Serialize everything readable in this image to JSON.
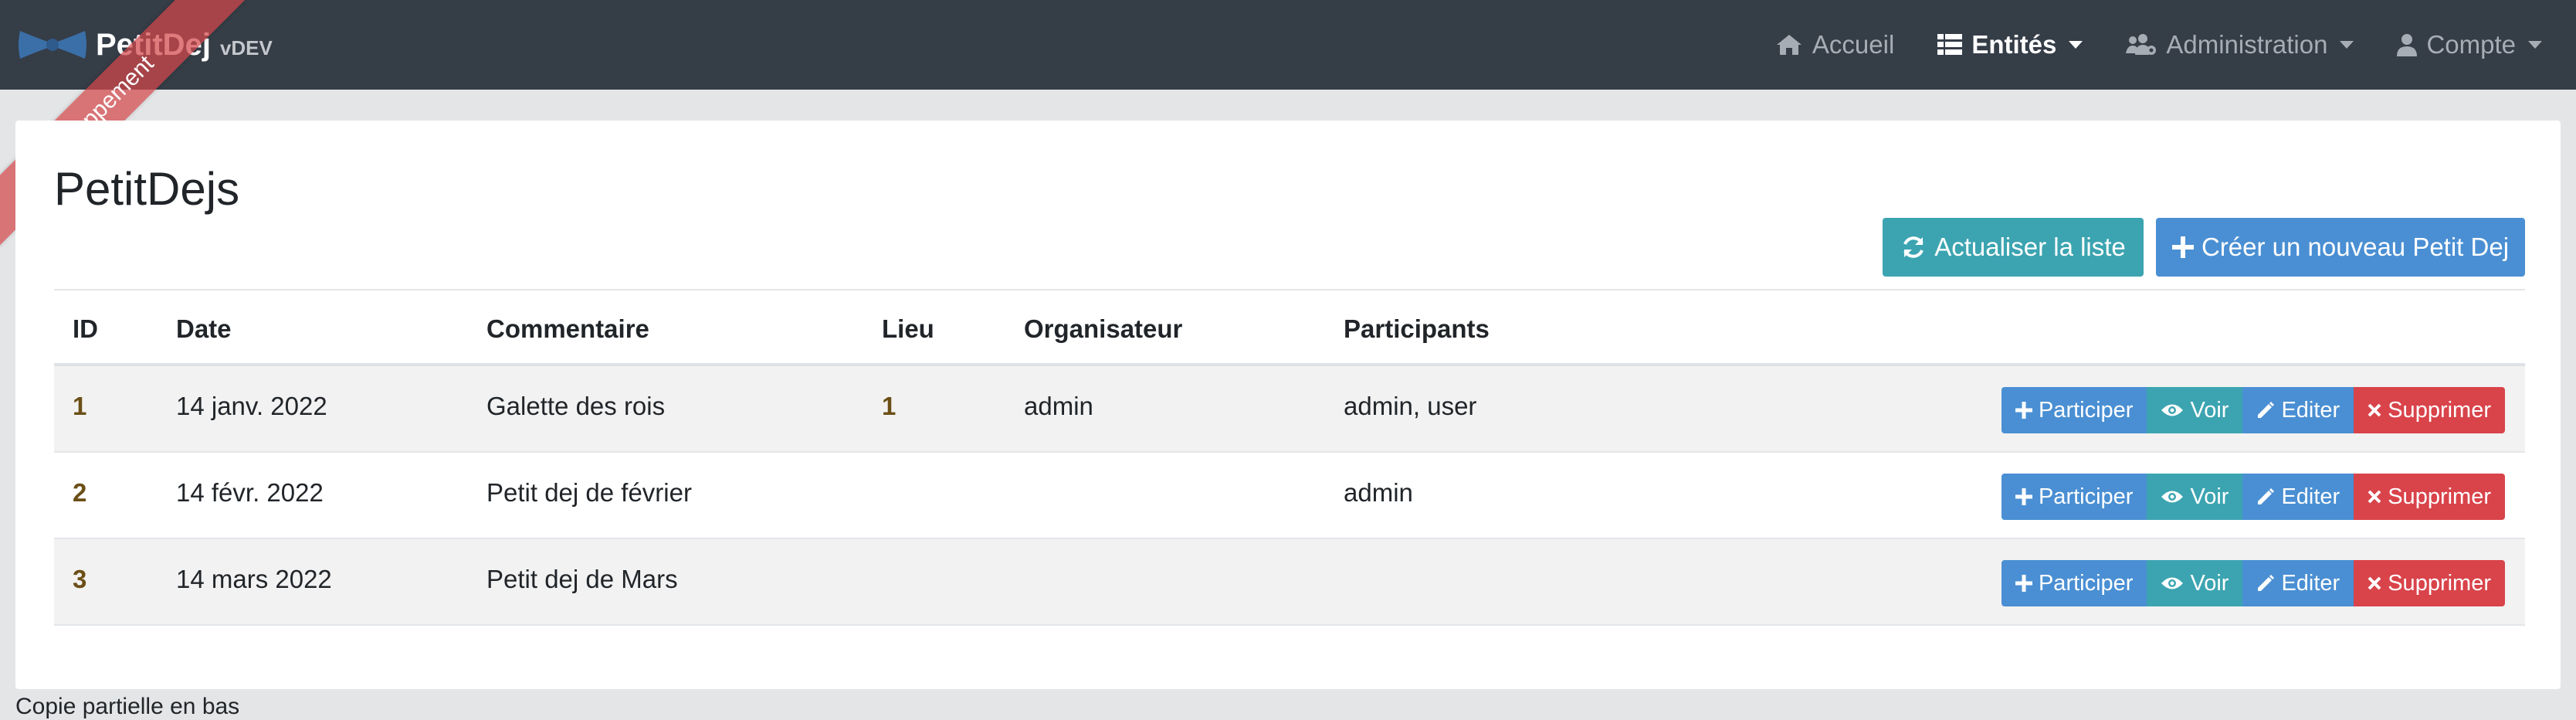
{
  "navbar": {
    "brand": "PetitDej",
    "version": "vDEV",
    "items": [
      {
        "label": "Accueil",
        "icon": "home-icon"
      },
      {
        "label": "Entités",
        "icon": "list-icon"
      },
      {
        "label": "Administration",
        "icon": "users-cog-icon"
      },
      {
        "label": "Compte",
        "icon": "user-icon"
      }
    ]
  },
  "ribbon": "Développement",
  "page": {
    "title": "PetitDejs",
    "refresh_label": "Actualiser la liste",
    "create_label": "Créer un nouveau Petit Dej"
  },
  "table": {
    "headers": [
      "ID",
      "Date",
      "Commentaire",
      "Lieu",
      "Organisateur",
      "Participants"
    ],
    "rows": [
      {
        "id": "1",
        "date": "14 janv. 2022",
        "comment": "Galette des rois",
        "lieu": "1",
        "organisateur": "admin",
        "participants": "admin, user"
      },
      {
        "id": "2",
        "date": "14 févr. 2022",
        "comment": "Petit dej de février",
        "lieu": "",
        "organisateur": "",
        "participants": "admin"
      },
      {
        "id": "3",
        "date": "14 mars 2022",
        "comment": "Petit dej de Mars",
        "lieu": "",
        "organisateur": "",
        "participants": ""
      }
    ],
    "actions": {
      "participate": "Participer",
      "view": "Voir",
      "edit": "Editer",
      "delete": "Supprimer"
    }
  },
  "colors": {
    "navbar": "#353d47",
    "primary": "#4a8fd3",
    "info": "#3ca4b1",
    "danger": "#d9434a",
    "link": "#6b4f16"
  },
  "footer": "Copie partielle en bas"
}
